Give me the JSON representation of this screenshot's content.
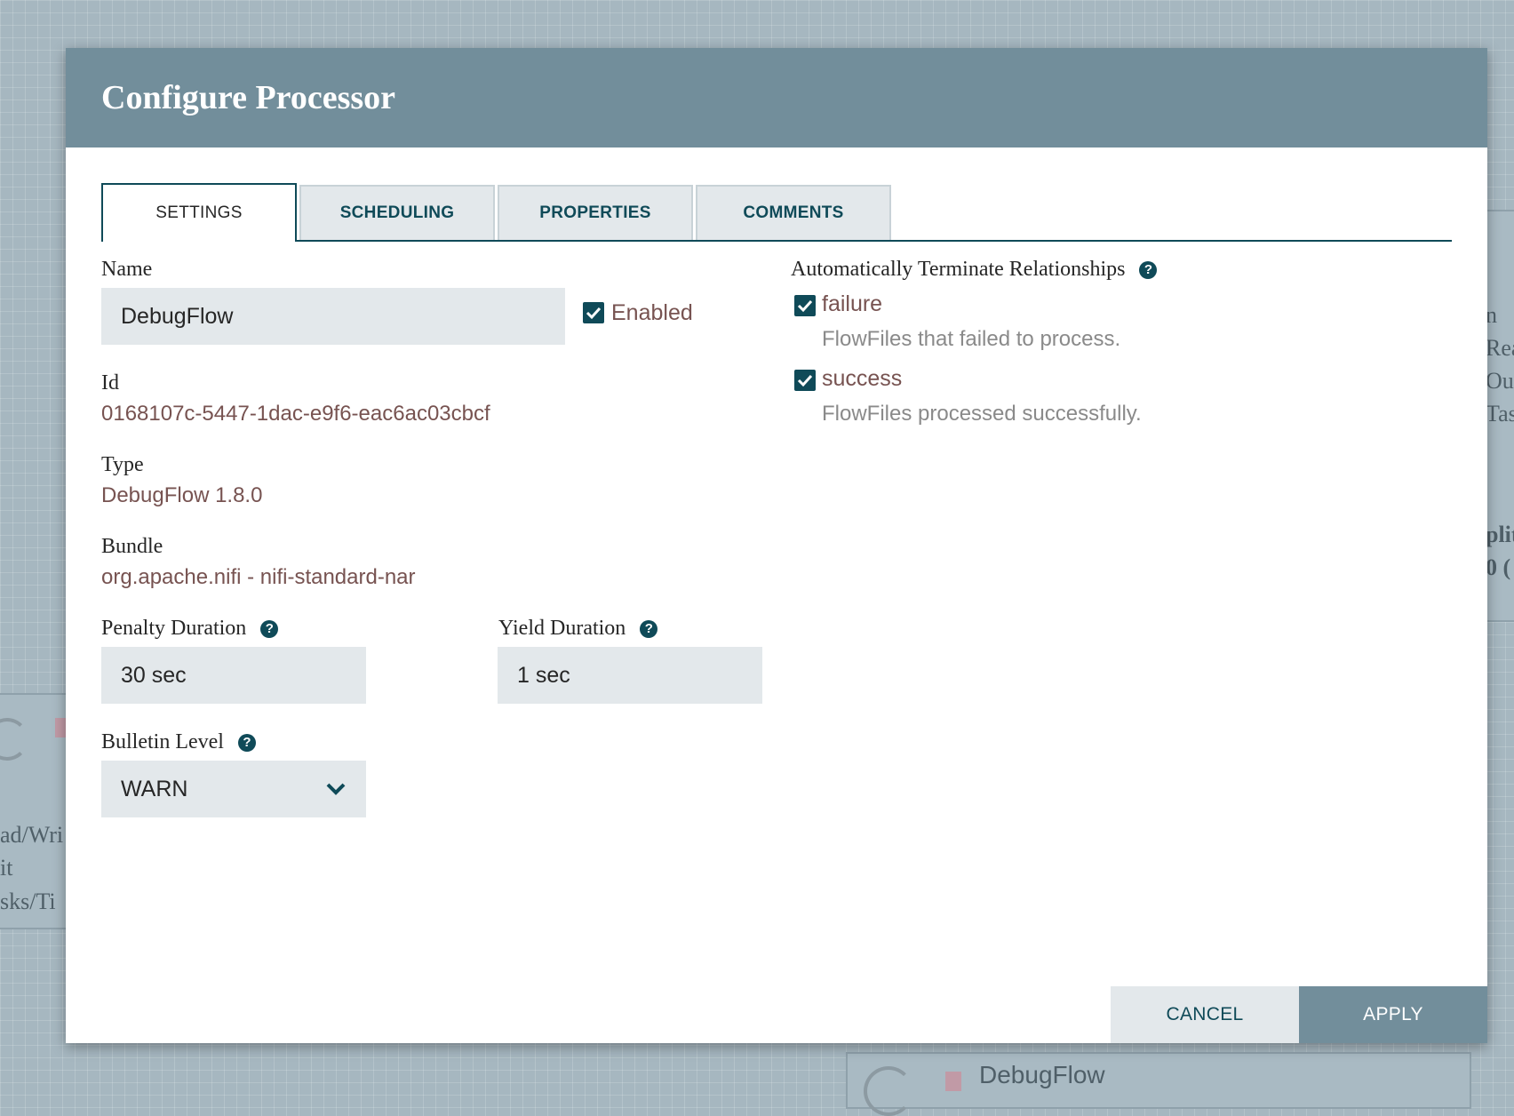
{
  "background": {
    "left_lines": [
      "ad/Wri",
      "it",
      "sks/Ti"
    ],
    "right_lines": [
      "n",
      "Rea",
      "Out",
      "Tas",
      "plit",
      "0 ("
    ],
    "bottom_processor_name": "DebugFlow"
  },
  "dialog": {
    "title": "Configure Processor",
    "tabs": [
      {
        "label": "SETTINGS",
        "active": true
      },
      {
        "label": "SCHEDULING",
        "active": false
      },
      {
        "label": "PROPERTIES",
        "active": false
      },
      {
        "label": "COMMENTS",
        "active": false
      }
    ],
    "settings": {
      "name_label": "Name",
      "name_value": "DebugFlow",
      "enabled_label": "Enabled",
      "enabled": true,
      "id_label": "Id",
      "id_value": "0168107c-5447-1dac-e9f6-eac6ac03cbcf",
      "type_label": "Type",
      "type_value": "DebugFlow 1.8.0",
      "bundle_label": "Bundle",
      "bundle_value": "org.apache.nifi - nifi-standard-nar",
      "penalty_label": "Penalty Duration",
      "penalty_value": "30 sec",
      "yield_label": "Yield Duration",
      "yield_value": "1 sec",
      "bulletin_label": "Bulletin Level",
      "bulletin_value": "WARN"
    },
    "relationships": {
      "heading": "Automatically Terminate Relationships",
      "items": [
        {
          "name": "failure",
          "checked": true,
          "description": "FlowFiles that failed to process."
        },
        {
          "name": "success",
          "checked": true,
          "description": "FlowFiles processed successfully."
        }
      ]
    },
    "buttons": {
      "cancel": "CANCEL",
      "apply": "APPLY"
    }
  },
  "colors": {
    "header": "#728e9b",
    "accent": "#0f4a58",
    "value_text": "#775351",
    "field_bg": "#e3e8eb"
  }
}
